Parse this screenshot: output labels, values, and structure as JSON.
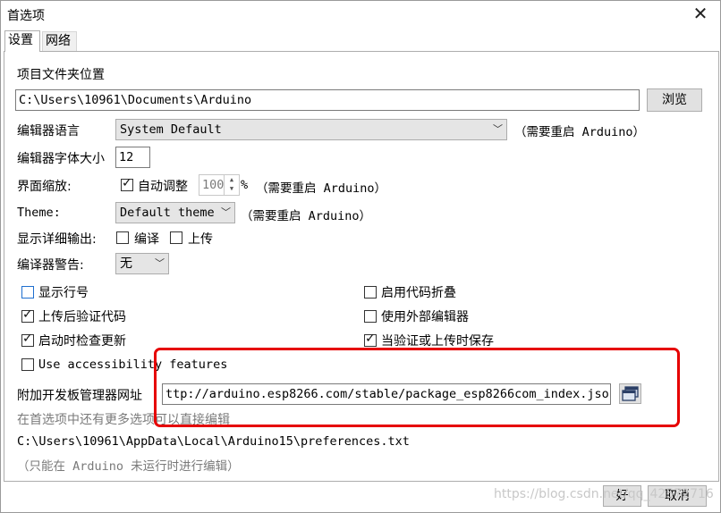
{
  "window": {
    "title": "首选项",
    "close_glyph": "✕"
  },
  "tabs": [
    {
      "label": "设置"
    },
    {
      "label": "网络"
    }
  ],
  "sketchbook": {
    "label": "项目文件夹位置",
    "path": "C:\\Users\\10961\\Documents\\Arduino",
    "browse_label": "浏览"
  },
  "language": {
    "label": "编辑器语言",
    "value": "System Default",
    "note": "（需要重启 Arduino）"
  },
  "font_size": {
    "label": "编辑器字体大小",
    "value": "12"
  },
  "scale": {
    "label": "界面缩放:",
    "auto_label": "自动调整",
    "auto_checked": true,
    "value": "100",
    "unit": "%",
    "note": "（需要重启 Arduino）"
  },
  "theme": {
    "label": "Theme:",
    "value": "Default theme",
    "note": "（需要重启 Arduino）"
  },
  "verbose": {
    "label": "显示详细输出:",
    "compile_label": "编译",
    "compile_checked": false,
    "upload_label": "上传",
    "upload_checked": false
  },
  "warnings": {
    "label": "编译器警告:",
    "value": "无"
  },
  "options_left": [
    {
      "label": "显示行号",
      "checked": false
    },
    {
      "label": "上传后验证代码",
      "checked": true
    },
    {
      "label": "启动时检查更新",
      "checked": true
    },
    {
      "label": "Use accessibility features",
      "checked": false
    }
  ],
  "options_right": [
    {
      "label": "启用代码折叠",
      "checked": false
    },
    {
      "label": "使用外部编辑器",
      "checked": false
    },
    {
      "label": "当验证或上传时保存",
      "checked": true
    }
  ],
  "board_urls": {
    "label": "附加开发板管理器网址",
    "value": "ttp://arduino.esp8266.com/stable/package_esp8266com_index.json",
    "hint": "在首选项中还有更多选项可以直接编辑"
  },
  "prefs_file": {
    "path": "C:\\Users\\10961\\AppData\\Local\\Arduino15\\preferences.txt",
    "note": "（只能在 Arduino 未运行时进行编辑）"
  },
  "buttons": {
    "ok": "好",
    "cancel": "取消"
  },
  "watermark": "https://blog.csdn.net/qq_42572716",
  "colors": {
    "highlight": "#e60000",
    "checkbox_focus": "#1f6fcf"
  }
}
